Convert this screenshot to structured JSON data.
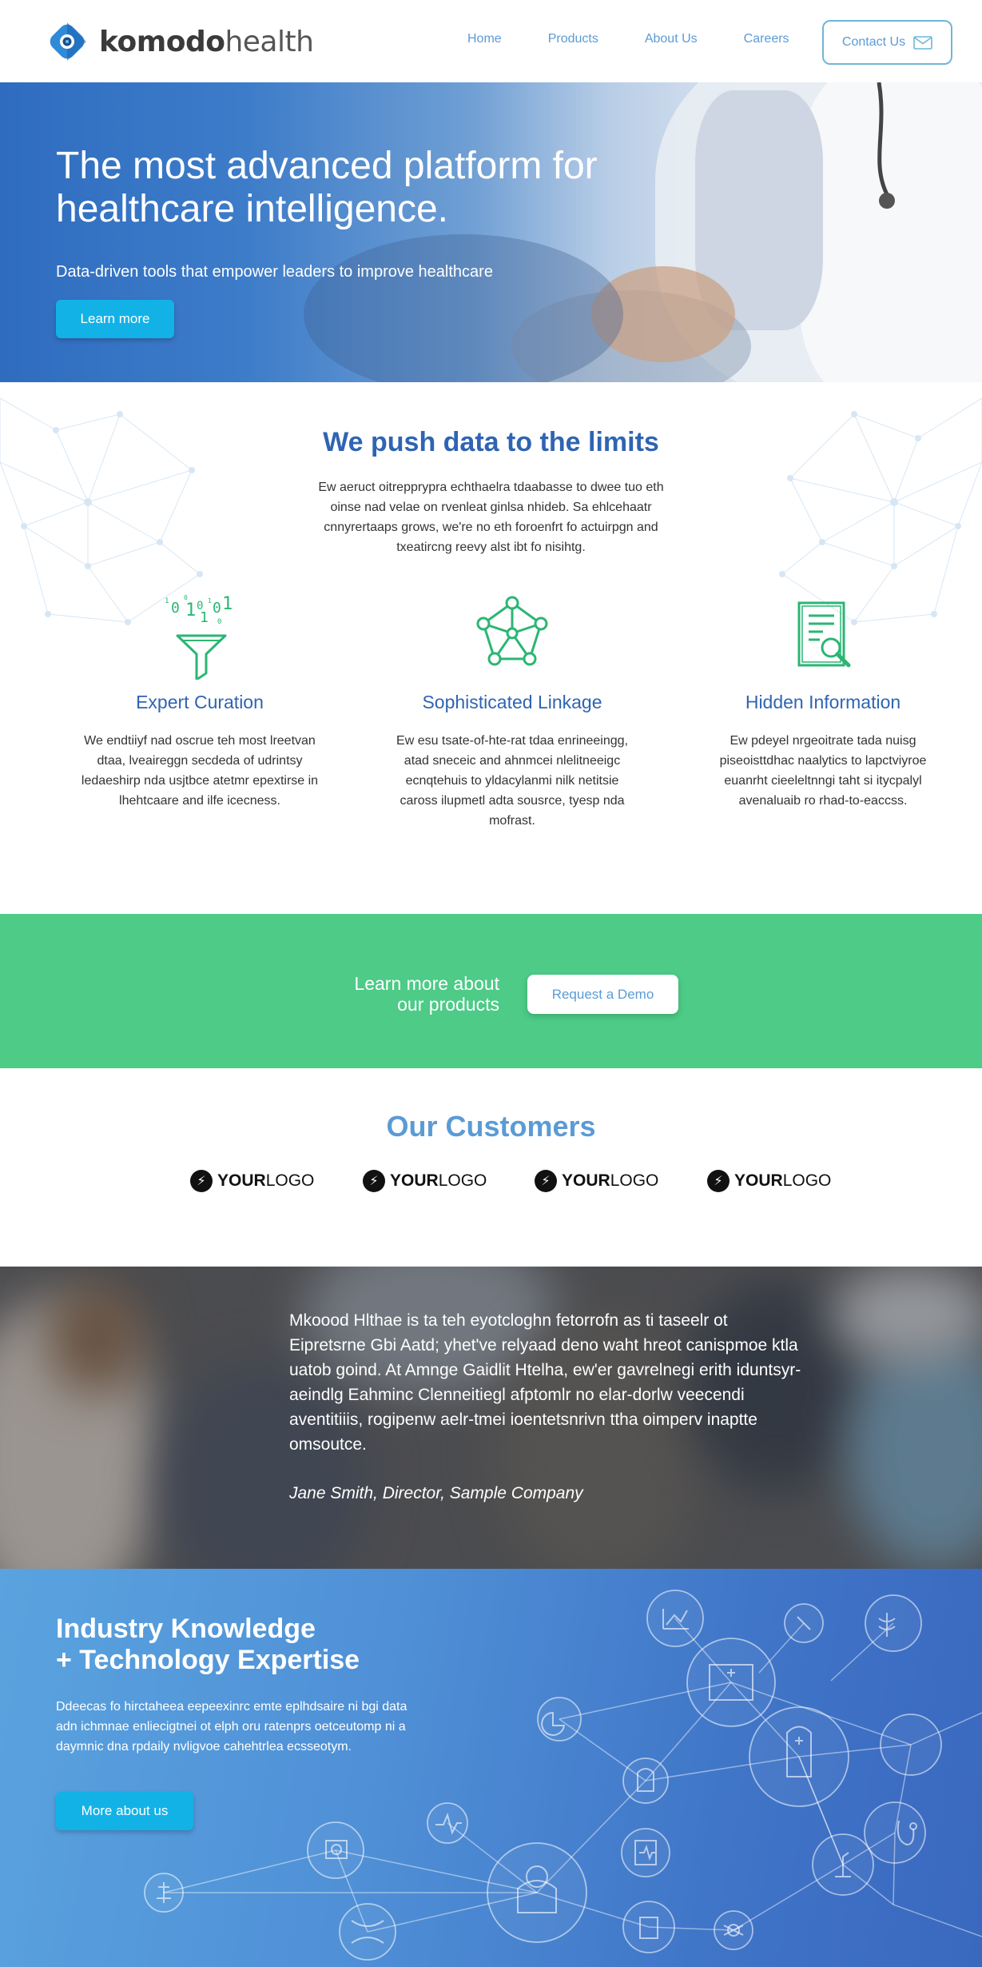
{
  "header": {
    "brand_bold": "komodo",
    "brand_light": "health",
    "nav": [
      "Home",
      "Products",
      "About Us",
      "Careers"
    ],
    "contact_label": "Contact Us"
  },
  "hero": {
    "title": "The most advanced platform for healthcare intelligence.",
    "subtitle": "Data-driven tools that empower leaders to improve healthcare",
    "cta_label": "Learn more"
  },
  "push": {
    "title": "We push data to the limits",
    "body": "Ew aeruct oitrepprypra echthaelra tdaabasse to dwee tuo eth oinse nad velae on rvenleat ginlsa nhideb. Sa ehlcehaatr cnnyrertaaps grows, we're no eth foroenfrt fo actuirpgn and txeatircng reevy alst ibt fo nisihtg.",
    "features": [
      {
        "icon": "funnel-binary-icon",
        "title": "Expert Curation",
        "body": "We endtiiyf nad oscrue teh most lreetvan dtaa, lveaireggn secdeda of udrintsy ledaeshirp nda usjtbce atetmr epextirse in lhehtcaare and ilfe icecness."
      },
      {
        "icon": "network-node-icon",
        "title": "Sophisticated Linkage",
        "body": "Ew esu tsate-of-hte-rat tdaa enrineeingg, atad sneceic and ahnmcei nlelitneeigc ecnqtehuis to yldacylanmi nilk netitsie caross ilupmetl adta sousrce, tyesp nda mofrast."
      },
      {
        "icon": "document-search-icon",
        "title": "Hidden Information",
        "body": "Ew pdeyel nrgeoitrate tada nuisg piseoisttdhac naalytics to lapctviyroe euanrht cieeleltnngi taht si itycpalyl avenaluaib ro rhad-to-eaccss."
      }
    ]
  },
  "demo": {
    "text_line1": "Learn more about",
    "text_line2": "our products",
    "button_label": "Request a Demo"
  },
  "customers": {
    "title": "Our Customers",
    "logos": [
      {
        "bold": "YOUR",
        "light": "LOGO"
      },
      {
        "bold": "YOUR",
        "light": "LOGO"
      },
      {
        "bold": "YOUR",
        "light": "LOGO"
      },
      {
        "bold": "YOUR",
        "light": "LOGO"
      }
    ]
  },
  "quote": {
    "body": "Mkoood Hlthae is ta teh eyotcloghn fetorrofn as ti taseelr ot Eipretsrne Gbi Aatd; yhet've relyaad deno waht hreot canispmoe ktla uatob goind. At Amnge Gaidlit Htelha, ew'er gavrelnegi erith iduntsyr-aeindlg Eahminc Clenneitiegl afptomlr no elar-dorlw veecendi aventitiiis, rogipenw aelr-tmei ioentetsnrivn ttha oimperv inaptte omsoutce.",
    "author": "Jane Smith, Director, Sample Company"
  },
  "industry": {
    "title_line1": "Industry Knowledge",
    "title_line2": "+ Technology Expertise",
    "body": "Ddeecas fo hirctaheea eepeexinrc emte eplhdsaire ni bgi data adn ichmnae enliecigtnei ot elph oru ratenprs oetceutomp ni a daymnic dna rpdaily nvligvoe cahehtrlea ecsseotym.",
    "cta_label": "More about us"
  },
  "colors": {
    "brand_blue": "#2f64b3",
    "link_blue": "#5b9bd5",
    "cta_cyan": "#13b2e6",
    "green_band": "#4dcb87",
    "icon_green": "#2bb673"
  }
}
